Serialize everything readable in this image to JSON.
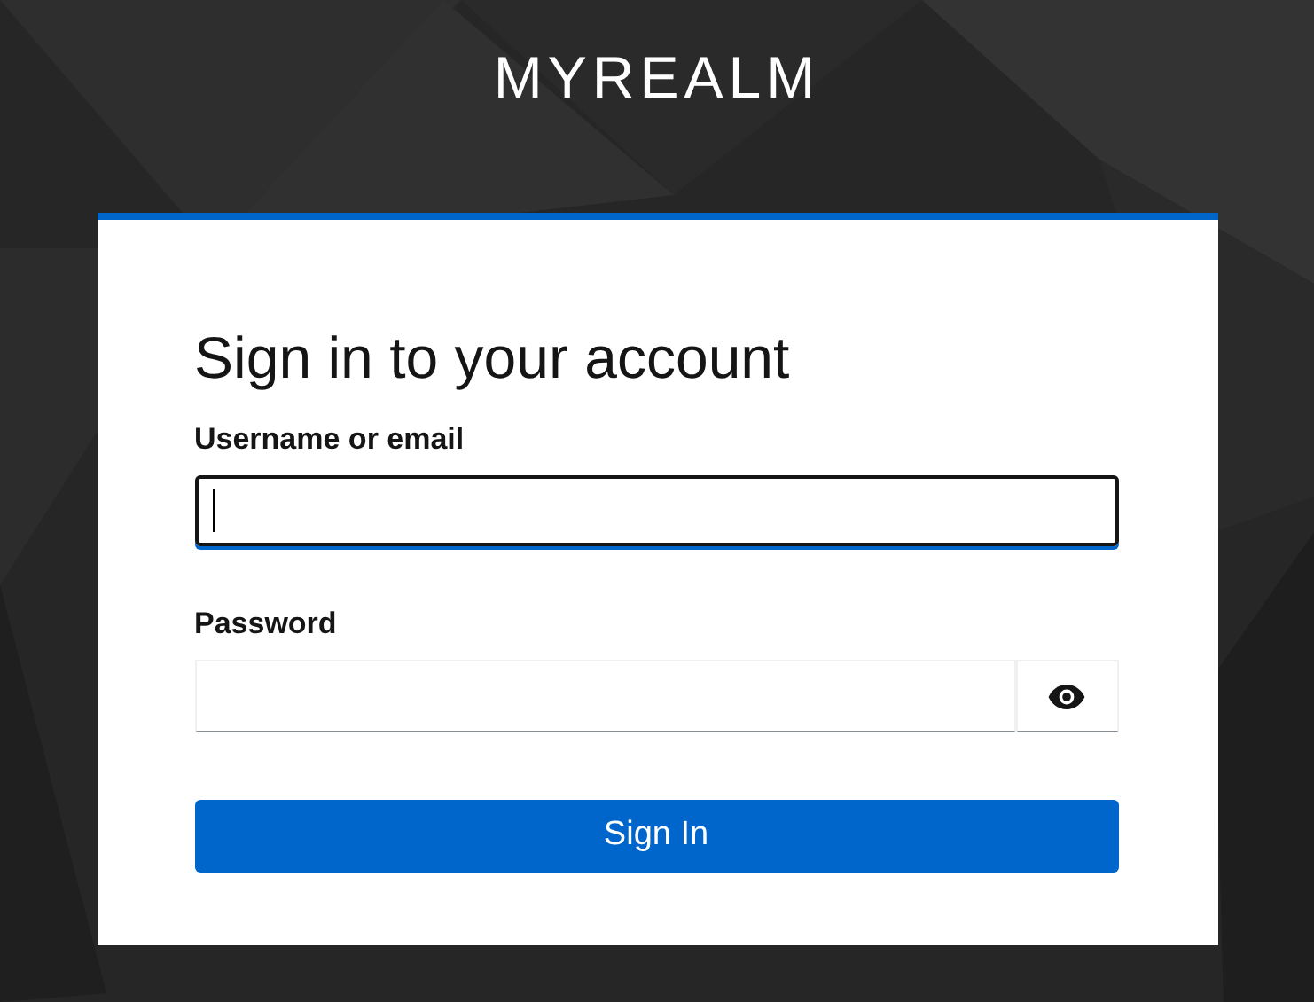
{
  "realm_title": "MYREALM",
  "heading": "Sign in to your account",
  "fields": [
    {
      "kind": "text",
      "label": "Username or email",
      "focused": true
    },
    {
      "kind": "password",
      "label": "Password",
      "focused": false
    }
  ],
  "submit_button": "Sign In"
}
